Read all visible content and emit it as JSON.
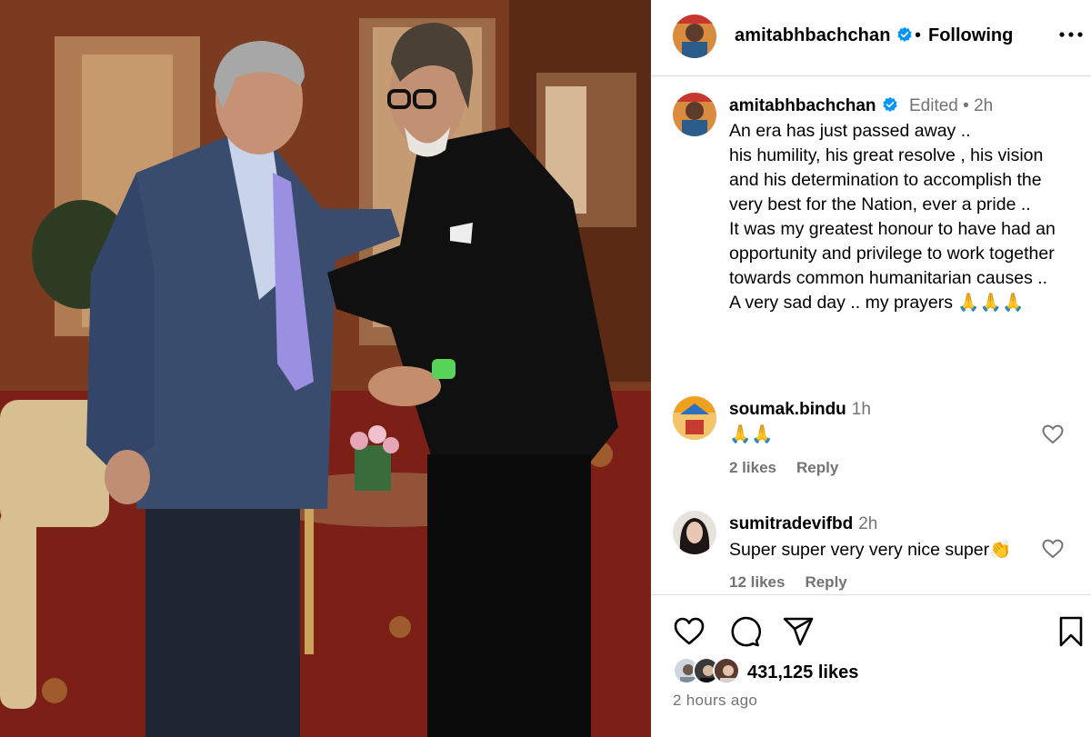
{
  "post": {
    "author": "amitabhbachchan",
    "follow_status": "Following",
    "dot": "•",
    "photo_alt": "Amitabh Bachchan greeting Ratan Tata"
  },
  "caption": {
    "username": "amitabhbachchan",
    "edited": "Edited",
    "dot": "•",
    "time": "2h",
    "text": "An era has just passed away ..\nhis humility, his great resolve , his vision and his determination to accomplish the very best for the Nation, ever a pride ..\nIt was my greatest honour to have had an opportunity and privilege to work together towards common humanitarian causes ..\nA very sad day .. my prayers 🙏🙏🙏"
  },
  "comments": [
    {
      "username": "soumak.bindu",
      "time": "1h",
      "text": "🙏🙏",
      "likes": "2 likes",
      "reply": "Reply"
    },
    {
      "username": "sumitradevifbd",
      "time": "2h",
      "text": "Super super very very nice super👏",
      "likes": "12 likes",
      "reply": "Reply"
    }
  ],
  "stats": {
    "likes": "431,125 likes",
    "posted": "2 hours ago"
  },
  "icons": {
    "header": [
      "verified-badge-icon",
      "more-options-icon"
    ],
    "actions": [
      "heart-icon",
      "comment-icon",
      "share-icon",
      "bookmark-icon"
    ]
  },
  "colors": {
    "verified": "#0095f6",
    "muted": "#737373",
    "border": "#dbdbdb"
  }
}
